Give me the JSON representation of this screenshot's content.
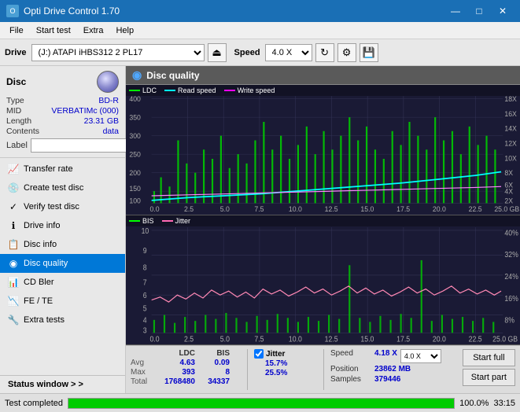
{
  "titleBar": {
    "title": "Opti Drive Control 1.70",
    "minBtn": "—",
    "maxBtn": "□",
    "closeBtn": "✕"
  },
  "menuBar": {
    "items": [
      "File",
      "Start test",
      "Extra",
      "Help"
    ]
  },
  "toolbar": {
    "driveLabel": "Drive",
    "driveValue": "(J:)  ATAPI iHBS312  2 PL17",
    "speedLabel": "Speed",
    "speedValue": "4.0 X"
  },
  "sidebar": {
    "discTitle": "Disc",
    "discInfo": {
      "typeLabel": "Type",
      "typeValue": "BD-R",
      "midLabel": "MID",
      "midValue": "VERBATIMc (000)",
      "lengthLabel": "Length",
      "lengthValue": "23.31 GB",
      "contentsLabel": "Contents",
      "contentsValue": "data",
      "labelLabel": "Label",
      "labelValue": ""
    },
    "navItems": [
      {
        "id": "transfer-rate",
        "label": "Transfer rate",
        "icon": "📈"
      },
      {
        "id": "create-test-disc",
        "label": "Create test disc",
        "icon": "💿"
      },
      {
        "id": "verify-test-disc",
        "label": "Verify test disc",
        "icon": "✓"
      },
      {
        "id": "drive-info",
        "label": "Drive info",
        "icon": "ℹ"
      },
      {
        "id": "disc-info",
        "label": "Disc info",
        "icon": "📋"
      },
      {
        "id": "disc-quality",
        "label": "Disc quality",
        "icon": "◉",
        "active": true
      },
      {
        "id": "cd-bler",
        "label": "CD Bler",
        "icon": "📊"
      },
      {
        "id": "fe-te",
        "label": "FE / TE",
        "icon": "📉"
      },
      {
        "id": "extra-tests",
        "label": "Extra tests",
        "icon": "🔧"
      }
    ],
    "statusWindow": "Status window > >"
  },
  "discQuality": {
    "panelTitle": "Disc quality",
    "chart1": {
      "legend": [
        {
          "id": "ldc",
          "label": "LDC",
          "color": "#00ff00"
        },
        {
          "id": "read-speed",
          "label": "Read speed",
          "color": "#00ffff"
        },
        {
          "id": "write-speed",
          "label": "Write speed",
          "color": "#ff00ff"
        }
      ],
      "yAxisMax": 400,
      "yAxisRight": [
        "18X",
        "16X",
        "14X",
        "12X",
        "10X",
        "8X",
        "6X",
        "4X",
        "2X"
      ],
      "xAxisMax": "25.0",
      "xAxisLabels": [
        "0.0",
        "2.5",
        "5.0",
        "7.5",
        "10.0",
        "12.5",
        "15.0",
        "17.5",
        "20.0",
        "22.5",
        "25.0"
      ]
    },
    "chart2": {
      "legend": [
        {
          "id": "bis",
          "label": "BIS",
          "color": "#00ff00"
        },
        {
          "id": "jitter",
          "label": "Jitter",
          "color": "#ff69b4"
        }
      ],
      "yAxisMax": 10,
      "yAxisRight": [
        "40%",
        "32%",
        "24%",
        "16%",
        "8%"
      ],
      "xAxisLabels": [
        "0.0",
        "2.5",
        "5.0",
        "7.5",
        "10.0",
        "12.5",
        "15.0",
        "17.5",
        "20.0",
        "22.5",
        "25.0"
      ]
    },
    "stats": {
      "columns": {
        "ldc": "LDC",
        "bis": "BIS"
      },
      "jitterLabel": "Jitter",
      "speedLabel": "Speed",
      "speedValue": "4.18 X",
      "speedSelect": "4.0 X",
      "rows": [
        {
          "id": "avg",
          "label": "Avg",
          "ldc": "4.63",
          "bis": "0.09",
          "jitter": "15.7%"
        },
        {
          "id": "max",
          "label": "Max",
          "ldc": "393",
          "bis": "8",
          "jitter": "25.5%"
        },
        {
          "id": "total",
          "label": "Total",
          "ldc": "1768480",
          "bis": "34337",
          "jitter": ""
        }
      ],
      "positionLabel": "Position",
      "positionValue": "23862 MB",
      "samplesLabel": "Samples",
      "samplesValue": "379446",
      "jitterChecked": true,
      "buttons": {
        "startFull": "Start full",
        "startPart": "Start part"
      }
    }
  },
  "statusBar": {
    "statusText": "Test completed",
    "progressPercent": 100,
    "progressLabel": "100.0%",
    "timeLabel": "33:15"
  }
}
